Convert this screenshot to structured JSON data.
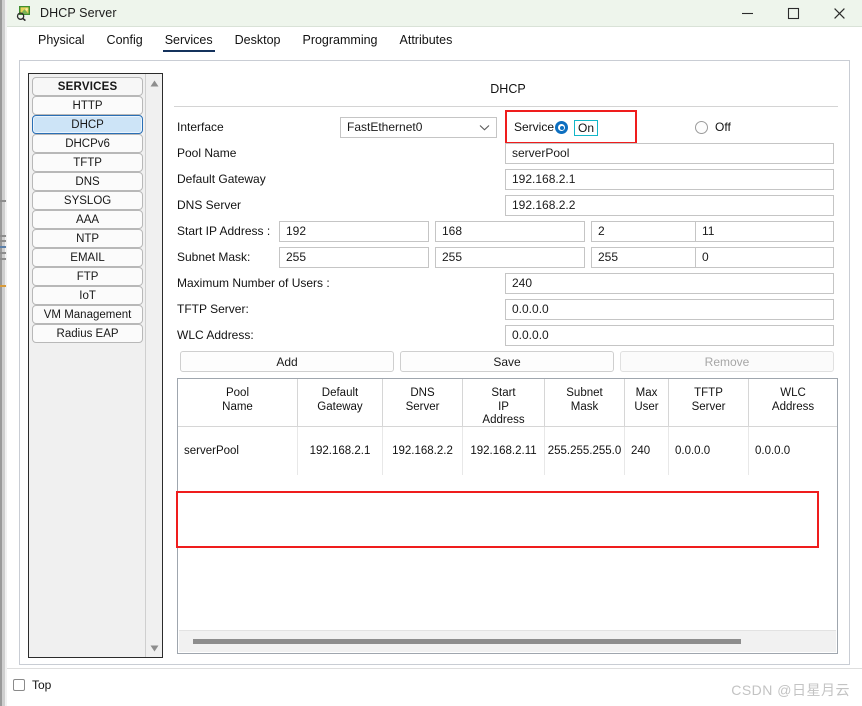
{
  "window": {
    "title": "DHCP Server",
    "icon": "server-magnifier-icon",
    "minimize_label": "minimize-icon",
    "maximize_label": "maximize-icon",
    "close_label": "close-icon"
  },
  "tabs": [
    {
      "label": "Physical",
      "active": false
    },
    {
      "label": "Config",
      "active": false
    },
    {
      "label": "Services",
      "active": true
    },
    {
      "label": "Desktop",
      "active": false
    },
    {
      "label": "Programming",
      "active": false
    },
    {
      "label": "Attributes",
      "active": false
    }
  ],
  "sidebar": {
    "header": "SERVICES",
    "items": [
      {
        "label": "HTTP",
        "selected": false
      },
      {
        "label": "DHCP",
        "selected": true
      },
      {
        "label": "DHCPv6",
        "selected": false
      },
      {
        "label": "TFTP",
        "selected": false
      },
      {
        "label": "DNS",
        "selected": false
      },
      {
        "label": "SYSLOG",
        "selected": false
      },
      {
        "label": "AAA",
        "selected": false
      },
      {
        "label": "NTP",
        "selected": false
      },
      {
        "label": "EMAIL",
        "selected": false
      },
      {
        "label": "FTP",
        "selected": false
      },
      {
        "label": "IoT",
        "selected": false
      },
      {
        "label": "VM Management",
        "selected": false
      },
      {
        "label": "Radius EAP",
        "selected": false
      }
    ],
    "scroll_up": "scroll-up-arrow",
    "scroll_down": "scroll-down-arrow"
  },
  "form": {
    "section_title": "DHCP",
    "interface": {
      "label": "Interface",
      "value": "FastEthernet0"
    },
    "service": {
      "label": "Service",
      "on_label": "On",
      "off_label": "Off",
      "selected": "On"
    },
    "pool_name": {
      "label": "Pool Name",
      "value": "serverPool"
    },
    "default_gateway": {
      "label": "Default Gateway",
      "value": "192.168.2.1"
    },
    "dns_server": {
      "label": "DNS Server",
      "value": "192.168.2.2"
    },
    "start_ip": {
      "label": "Start IP Address :",
      "octets": [
        "192",
        "168",
        "2",
        "11"
      ]
    },
    "subnet_mask": {
      "label": "Subnet Mask:",
      "octets": [
        "255",
        "255",
        "255",
        "0"
      ]
    },
    "max_users": {
      "label": "Maximum Number of Users :",
      "value": "240"
    },
    "tftp_server": {
      "label": "TFTP Server:",
      "value": "0.0.0.0"
    },
    "wlc_address": {
      "label": "WLC Address:",
      "value": "0.0.0.0"
    },
    "buttons": {
      "add": "Add",
      "save": "Save",
      "remove": "Remove",
      "remove_disabled": true
    }
  },
  "table": {
    "columns": [
      "Pool\nName",
      "Default\nGateway",
      "DNS\nServer",
      "Start\nIP\nAddress",
      "Subnet\nMask",
      "Max\nUser",
      "TFTP\nServer",
      "WLC\nAddress"
    ],
    "column_labels": {
      "pool_name": "Pool Name",
      "default_gateway": "Default Gateway",
      "dns_server": "DNS Server",
      "start_ip_address": "Start IP Address",
      "subnet_mask": "Subnet Mask",
      "max_user": "Max User",
      "tftp_server": "TFTP Server",
      "wlc_address": "WLC Address"
    },
    "rows": [
      {
        "pool_name": "serverPool",
        "default_gateway": "192.168.2.1",
        "dns_server": "192.168.2.2",
        "start_ip_address": "192.168.2.11",
        "subnet_mask": "255.255.255.0",
        "max_user": "240",
        "tftp_server": "0.0.0.0",
        "wlc_address": "0.0.0.0"
      }
    ]
  },
  "bottom": {
    "top_checkbox_label": "Top",
    "top_checked": false,
    "watermark": "CSDN @日星月云"
  },
  "colors": {
    "highlight_red": "#ef1d1d",
    "focus_cyan": "#13b7c9",
    "radio_blue": "#0d6fc0",
    "tab_underline": "#14325c",
    "selected_item": "#cde4f7",
    "titlebar": "#eef5ec"
  }
}
